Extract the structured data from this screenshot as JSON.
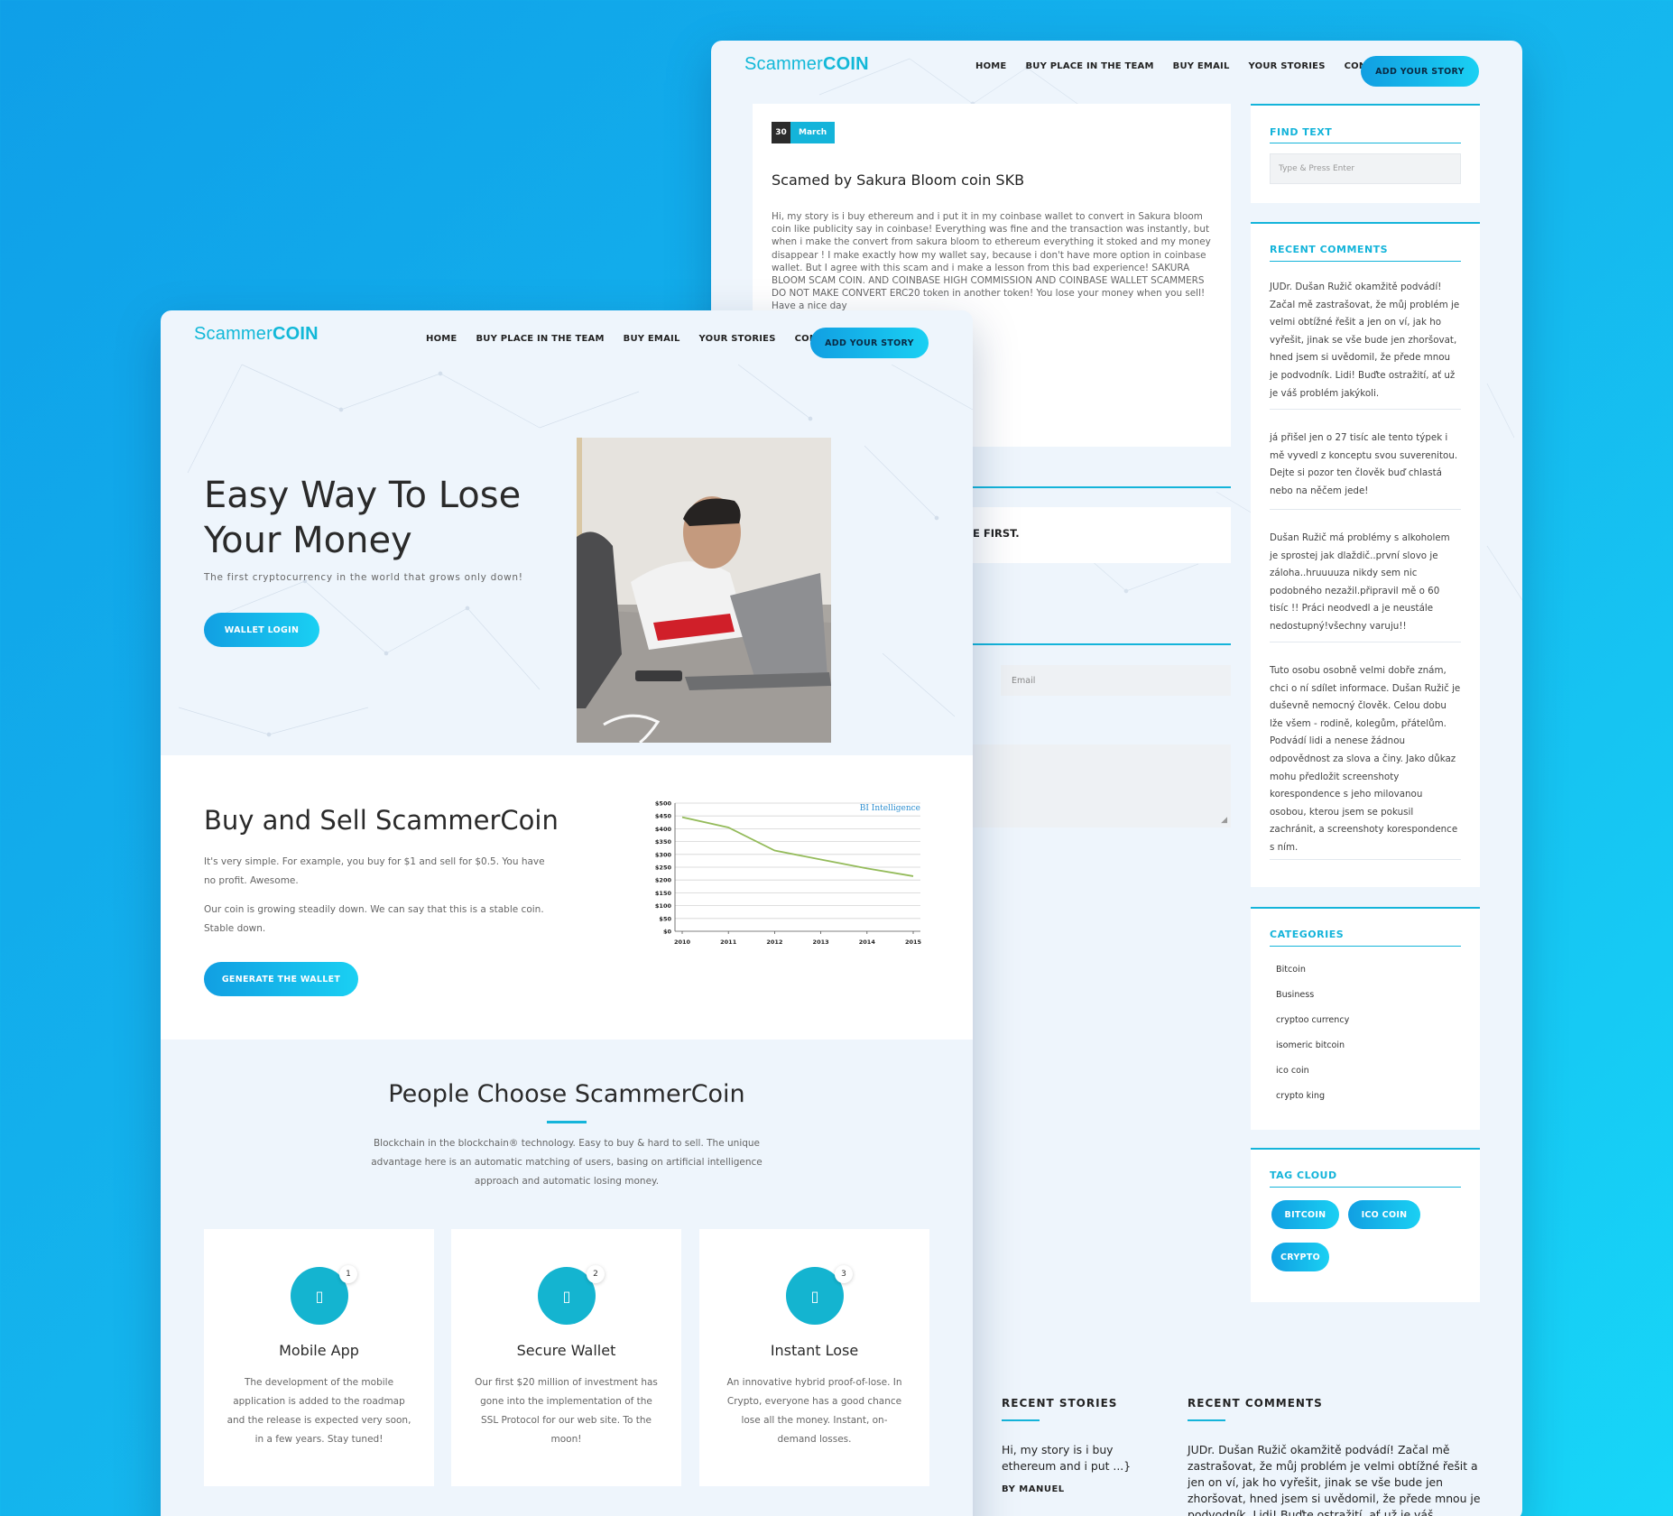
{
  "brand": {
    "prefix": "Scammer",
    "suffix": "COIN"
  },
  "nav": {
    "home": "HOME",
    "buy_place": "BUY PLACE IN THE TEAM",
    "buy_email": "BUY EMAIL",
    "stories": "YOUR STORIES",
    "contact": "CONTACT",
    "cta": "ADD YOUR STORY"
  },
  "post": {
    "date_day": "30",
    "date_month": "March",
    "title": "Scamed by Sakura Bloom coin SKB",
    "body": "Hi, my story is i buy ethereum and i put it in my coinbase wallet to convert in Sakura bloom coin like publicity say in coinbase! Everything was fine and the transaction was instantly, but when i make the convert from sakura bloom to ethereum everything it stoked and my money disappear ! I make exactly how my wallet say, because i don't have more option in coinbase wallet. But I agree with this scam and i make a lesson from this bad experience! SAKURA BLOOM SCAM COIN. AND COINBASE HIGH COMMISSION AND COINBASE WALLET SCAMMERS DO NOT MAKE CONVERT ERC20 token in another token! You lose your money when you sell! Have a nice day"
  },
  "comment_form": {
    "partial_heading": "E FIRST.",
    "email_placeholder": "Email"
  },
  "sidebar": {
    "find": {
      "title": "FIND TEXT",
      "placeholder": "Type & Press Enter"
    },
    "recent_comments": {
      "title": "RECENT COMMENTS",
      "items": [
        "JUDr. Dušan Ružič okamžitě podvádí! Začal mě zastrašovat, že můj problém je velmi obtížné řešit a jen on ví, jak ho vyřešit, jinak se vše bude jen zhoršovat, hned jsem si uvědomil, že přede mnou je podvodník. Lidi! Buďte ostražití, ať už je váš problém jakýkoli.",
        "já přišel jen o 27 tisíc ale tento týpek i mě vyvedl z konceptu svou suverenitou. Dejte si pozor ten člověk buď chlastá nebo na něčem jede!",
        "Dušan Ružič má problémy s alkoholem je sprostej jak dlaždič..první slovo je záloha..hruuuuza nikdy sem nic podobného nezažil.připravil mě o 60 tisíc !! Práci neodvedl a je neustále nedostupný!všechny varuju!!",
        "Tuto osobu osobně velmi dobře znám, chci o ní sdílet informace. Dušan Ružič je duševně nemocný člověk. Celou dobu lže všem - rodině, kolegům, přátelům. Podvádí lidi a nenese žádnou odpovědnost za slova a činy. Jako důkaz mohu předložit screenshoty korespondence s jeho milovanou osobou, kterou jsem se pokusil zachránit, a screenshoty korespondence s ním."
      ]
    },
    "categories": {
      "title": "CATEGORIES",
      "items": [
        "Bitcoin",
        "Business",
        "cryptoo currency",
        "isomeric bitcoin",
        "ico coin",
        "crypto king"
      ]
    },
    "tags": {
      "title": "TAG CLOUD",
      "items": [
        "BITCOIN",
        "ICO COIN",
        "CRYPTO"
      ]
    }
  },
  "footer": {
    "stories_title": "RECENT STORIES",
    "story_excerpt": "Hi, my story is i buy ethereum and i put ...}",
    "story_author": "BY MANUEL",
    "comments_title": "RECENT COMMENTS",
    "comment_excerpt": "JUDr. Dušan Ružič okamžitě podvádí! Začal mě zastrašovat, že můj problém je velmi obtížné řešit a jen on ví, jak ho vyřešit, jinak se vše bude jen zhoršovat, hned jsem si uvědomil, že přede mnou je podvodník. Lidi! Buďte ostražití, ať už je váš problém jakýkoli."
  },
  "hero": {
    "title": "Easy Way To Lose Your Money",
    "subtitle": "The first cryptocurrency in the world that grows only down!",
    "button": "WALLET LOGIN"
  },
  "buy_sell": {
    "title": "Buy and Sell ScammerCoin",
    "p1": "It's very simple. For example, you buy for $1 and sell for $0.5. You have no profit. Awesome.",
    "p2": "Our coin is growing steadily down. We can say that this is a stable coin. Stable down.",
    "button": "GENERATE THE WALLET"
  },
  "chart_data": {
    "type": "line",
    "watermark": "BI Intelligence",
    "x": [
      "2010",
      "2011",
      "2012",
      "2013",
      "2014",
      "2015"
    ],
    "y_ticks": [
      "$0",
      "$50",
      "$100",
      "$150",
      "$200",
      "$250",
      "$300",
      "$350",
      "$400",
      "$450",
      "$500"
    ],
    "values": [
      445,
      405,
      315,
      280,
      245,
      215
    ],
    "ylim": [
      0,
      500
    ],
    "line_color": "#94bb5a"
  },
  "choose": {
    "title": "People Choose ScammerCoin",
    "lead": "Blockchain in the blockchain® technology. Easy to buy & hard to sell. The unique advantage here is an automatic matching of users, basing on artificial intelligence approach and automatic losing money.",
    "features": [
      {
        "num": "1",
        "title": "Mobile App",
        "text": "The development of the mobile application is added to the roadmap and the release is expected very soon, in a few years. Stay tuned!"
      },
      {
        "num": "2",
        "title": "Secure Wallet",
        "text": "Our first $20 million of investment has gone into the implementation of the SSL Protocol for our web site. To the moon!"
      },
      {
        "num": "3",
        "title": "Instant Lose",
        "text": "An innovative hybrid proof-of-lose. In Crypto, everyone has a good chance lose all the money. Instant, on-demand losses."
      }
    ]
  },
  "colors": {
    "accent": "#14b4da",
    "page_bg": "#eef5fc",
    "bg_gradient_start": "#0f9fe8",
    "bg_gradient_end": "#17d6f8"
  }
}
